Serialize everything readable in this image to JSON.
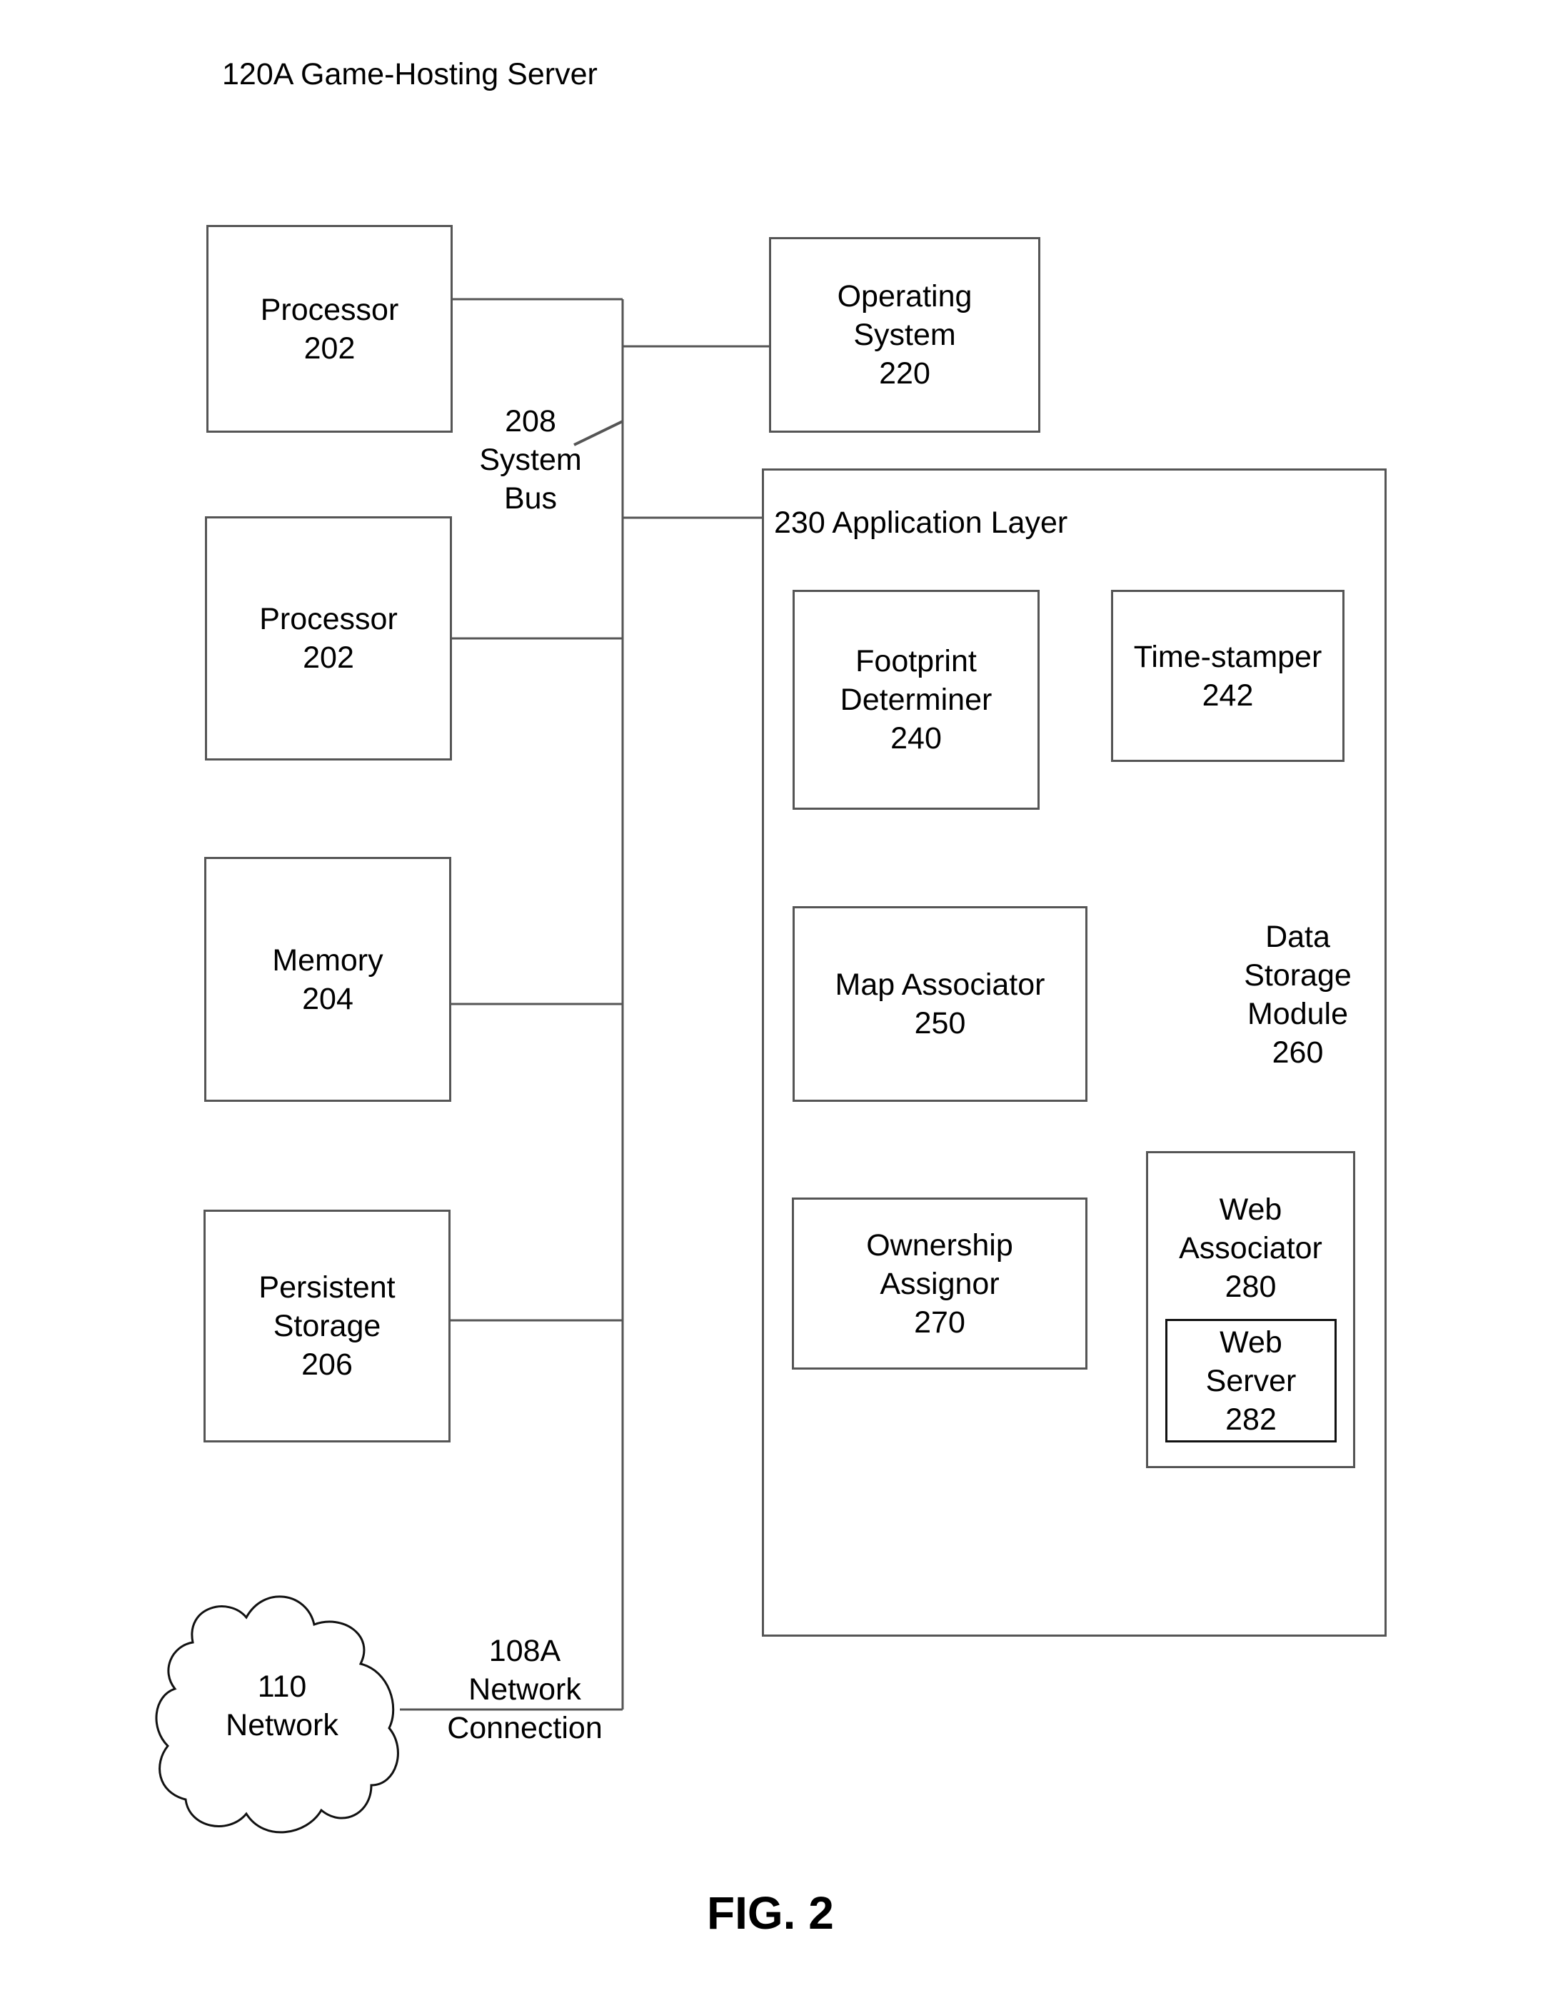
{
  "title": "120A Game-Hosting Server",
  "figure_label": "FIG. 2",
  "system_bus": {
    "lines": [
      "208",
      "System",
      "Bus"
    ]
  },
  "network_connection": {
    "lines": [
      "108A",
      "Network",
      "Connection"
    ]
  },
  "network": {
    "lines": [
      "110",
      "Network"
    ]
  },
  "hardware": [
    {
      "id": "processor-1",
      "lines": [
        "Processor",
        "202"
      ]
    },
    {
      "id": "processor-2",
      "lines": [
        "Processor",
        "202"
      ]
    },
    {
      "id": "memory",
      "lines": [
        "Memory",
        "204"
      ]
    },
    {
      "id": "persistent-storage",
      "lines": [
        "Persistent",
        "Storage",
        "206"
      ]
    }
  ],
  "operating_system": {
    "lines": [
      "Operating",
      "System",
      "220"
    ]
  },
  "application_layer": {
    "label": "230 Application Layer",
    "footprint_determiner": {
      "lines": [
        "Footprint",
        "Determiner",
        "240"
      ]
    },
    "time_stamper": {
      "lines": [
        "Time-stamper",
        "242"
      ]
    },
    "map_associator": {
      "lines": [
        "Map Associator",
        "250"
      ]
    },
    "data_storage": {
      "lines": [
        "Data",
        "Storage",
        "Module",
        "260"
      ]
    },
    "ownership_assignor": {
      "lines": [
        "Ownership",
        "Assignor",
        "270"
      ]
    },
    "web_associator": {
      "lines": [
        "Web",
        "Associator",
        "280"
      ]
    },
    "web_server": {
      "lines": [
        "Web",
        "Server",
        "282"
      ]
    }
  }
}
